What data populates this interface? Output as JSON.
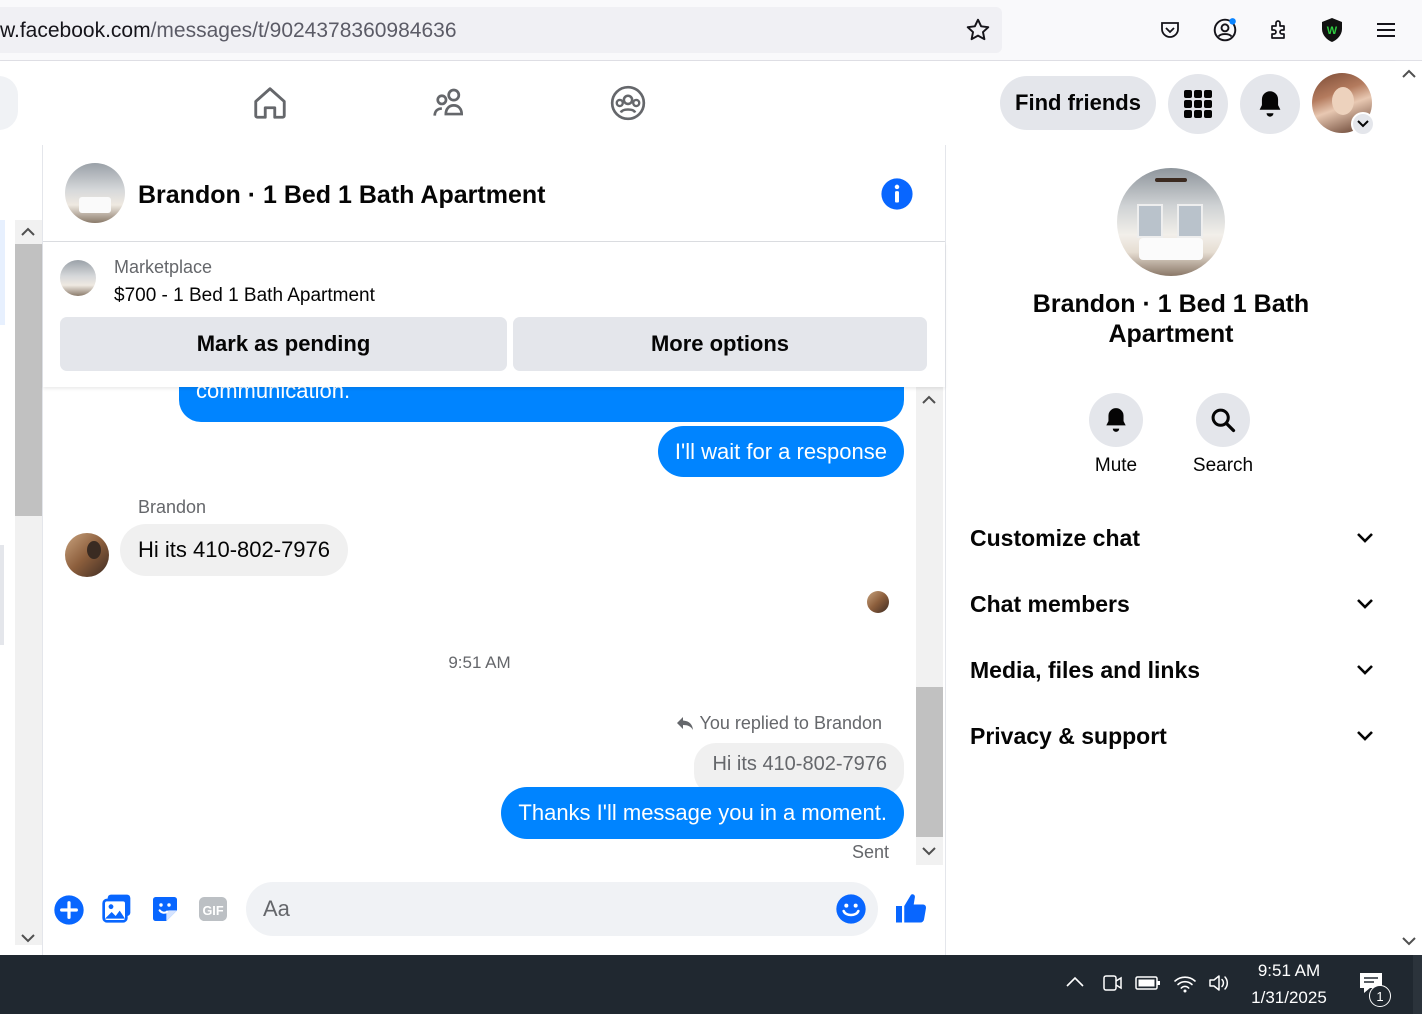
{
  "browser": {
    "url_host": "w.facebook.com",
    "url_path": "/messages/t/9024378360984636"
  },
  "nav": {
    "find_friends_label": "Find friends"
  },
  "chat": {
    "title": "Brandon · 1 Bed 1 Bath Apartment",
    "marketplace_label": "Marketplace",
    "listing": "$700 - 1 Bed 1 Bath Apartment",
    "mark_pending_label": "Mark as pending",
    "more_options_label": "More options"
  },
  "messages": {
    "partial_outgoing": "communication.",
    "wait_msg": "I'll wait for a response",
    "sender_name": "Brandon",
    "brandon_msg": "Hi its 410-802-7976",
    "timestamp": "9:51 AM",
    "replied_to": "You replied to Brandon",
    "quoted_msg": "Hi its 410-802-7976",
    "reply_msg": "Thanks I'll message you in a moment.",
    "status": "Sent"
  },
  "composer": {
    "placeholder": "Aa"
  },
  "panel": {
    "name": "Brandon · 1 Bed 1 Bath Apartment",
    "mute_label": "Mute",
    "search_label": "Search",
    "sections": [
      "Customize chat",
      "Chat members",
      "Media, files and links",
      "Privacy & support"
    ]
  },
  "taskbar": {
    "time": "9:51 AM",
    "date": "1/31/2025",
    "notification_count": "1"
  },
  "colors": {
    "messenger_blue": "#0084ff",
    "fb_blue": "#0866ff",
    "button_gray": "#e4e6eb"
  }
}
